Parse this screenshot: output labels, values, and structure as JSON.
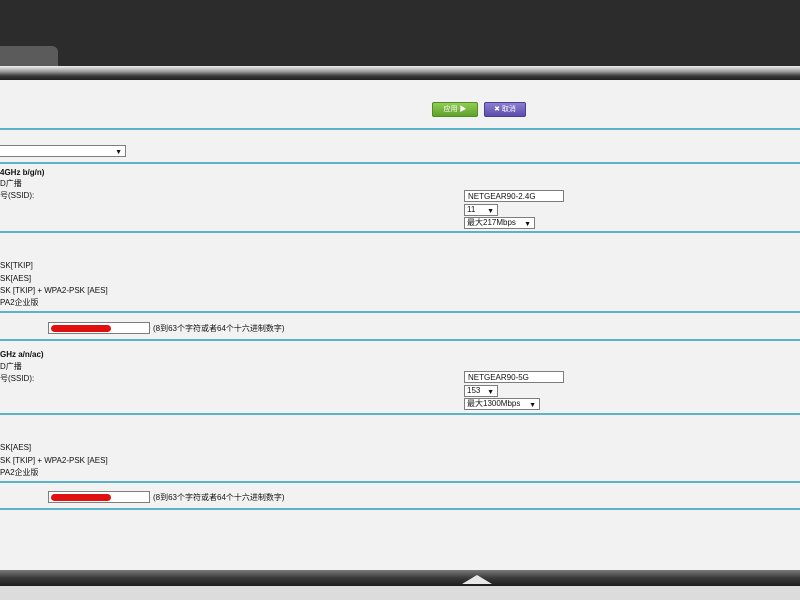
{
  "toolbar": {
    "apply_label": "应用 ▶",
    "cancel_label": "✖ 取消"
  },
  "band24": {
    "title": "4GHz b/g/n)",
    "ssid_broadcast": "D广播",
    "ssid_label": "号(SSID):",
    "ssid_value": "NETGEAR90-2.4G",
    "channel": "11",
    "mode": "最大217Mbps"
  },
  "security24": {
    "options": [
      "SK[TKIP]",
      "SK[AES]",
      "SK [TKIP] + WPA2-PSK [AES]",
      "PA2企业版"
    ]
  },
  "passphrase_hint": "(8到63个字符或者64个十六进制数字)",
  "band5": {
    "title": "GHz a/n/ac)",
    "ssid_broadcast": "D广播",
    "ssid_label": "号(SSID):",
    "ssid_value": "NETGEAR90-5G",
    "channel": "153",
    "mode": "最大1300Mbps"
  },
  "security5": {
    "options": [
      "SK[AES]",
      "SK [TKIP] + WPA2-PSK [AES]",
      "PA2企业版"
    ]
  },
  "icons": {
    "apply": "play-arrow-icon",
    "cancel": "close-x-icon",
    "collapse": "up-arrow-icon"
  },
  "colors": {
    "divider": "#5cb2c9",
    "apply": "#6aaf32",
    "cancel": "#6a5bbd",
    "redaction": "#e01010"
  }
}
